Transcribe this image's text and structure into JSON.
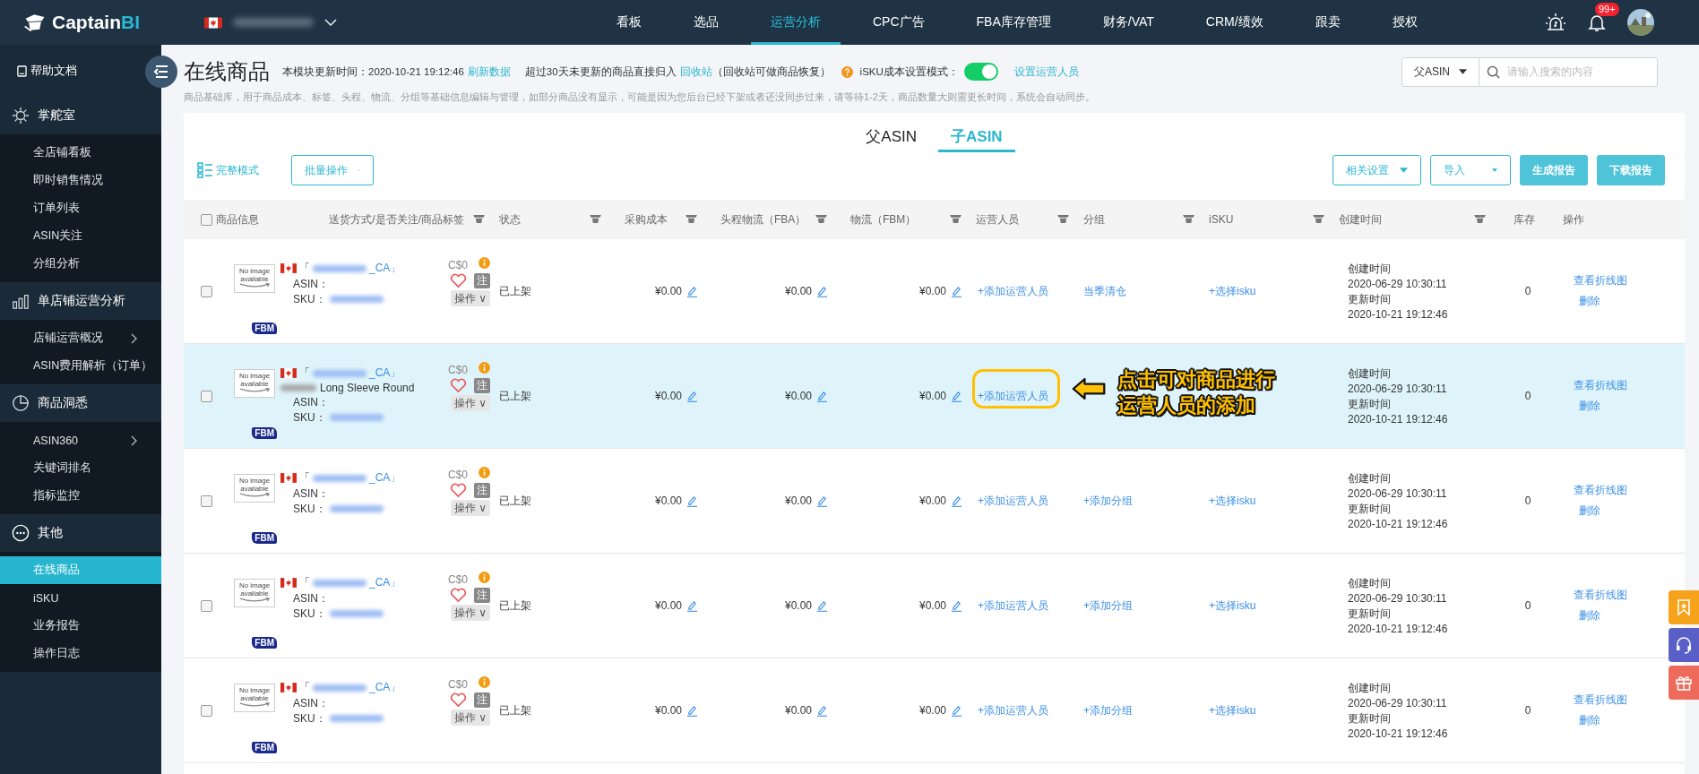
{
  "topbar": {
    "logo": [
      "Captain",
      "BI"
    ],
    "nav": [
      {
        "label": "看板",
        "selected": false
      },
      {
        "label": "选品",
        "selected": false
      },
      {
        "label": "运营分析",
        "selected": true
      },
      {
        "label": "CPC广告",
        "selected": false
      },
      {
        "label": "FBA库存管理",
        "selected": false
      },
      {
        "label": "财务/VAT",
        "selected": false
      },
      {
        "label": "CRM/绩效",
        "selected": false
      },
      {
        "label": "跟卖",
        "selected": false
      },
      {
        "label": "授权",
        "selected": false
      }
    ],
    "notifications": "99+"
  },
  "sidebar": {
    "help": "帮助文档",
    "sections": [
      {
        "label": "掌舵室",
        "items": [
          {
            "label": "全店铺看板",
            "selected": false,
            "submenu": false
          },
          {
            "label": "即时销售情况",
            "selected": false,
            "submenu": false
          },
          {
            "label": "订单列表",
            "selected": false,
            "submenu": false
          },
          {
            "label": "ASIN关注",
            "selected": false,
            "submenu": false
          },
          {
            "label": "分组分析",
            "selected": false,
            "submenu": false
          }
        ]
      },
      {
        "label": "单店铺运营分析",
        "items": [
          {
            "label": "店铺运营概况",
            "selected": false,
            "submenu": true
          },
          {
            "label": "ASIN费用解析（订单）",
            "selected": false,
            "submenu": false
          }
        ]
      },
      {
        "label": "商品洞悉",
        "items": [
          {
            "label": "ASIN360",
            "selected": false,
            "submenu": true
          },
          {
            "label": "关键词排名",
            "selected": false,
            "submenu": false
          },
          {
            "label": "指标监控",
            "selected": false,
            "submenu": false
          }
        ]
      },
      {
        "label": "其他",
        "items": [
          {
            "label": "在线商品",
            "selected": true,
            "submenu": false
          },
          {
            "label": "iSKU",
            "selected": false,
            "submenu": false
          },
          {
            "label": "业务报告",
            "selected": false,
            "submenu": false
          },
          {
            "label": "操作日志",
            "selected": false,
            "submenu": false
          }
        ]
      }
    ]
  },
  "page": {
    "title": "在线商品",
    "update_label": "本模块更新时间：2020-10-21 19:12:46",
    "refresh_link": "刷新数据",
    "recycle_text": "超过30天未更新的商品直接归入",
    "recycle_link": "回收站",
    "recycle_note": "（回收站可做商品恢复）",
    "isku_label": "iSKU成本设置模式：",
    "isku_mode_on": true,
    "set_operator_link": "设置运营人员",
    "search": {
      "scope": "父ASIN",
      "placeholder": "请输入搜索的内容"
    },
    "description": "商品基础库，用于商品成本、标签、头程、物流、分组等基础信息编辑与管理，如部分商品没有显示，可能是因为您后台已经下架或者还没同步过来，请等待1-2天，商品数量大则需更长时间，系统会自动同步。"
  },
  "asin_tabs": [
    {
      "label": "父ASIN",
      "selected": false
    },
    {
      "label": "子ASIN",
      "selected": true
    }
  ],
  "toolbar": {
    "mode": "完整模式",
    "batch": "批量操作",
    "settings": "相关设置",
    "import": "导入",
    "generate": "生成报告",
    "download": "下载报告"
  },
  "table": {
    "select_all": false,
    "columns": [
      {
        "label": "商品信息",
        "filter": false
      },
      {
        "label": "送货方式/是否关注/商品标签",
        "filter": true
      },
      {
        "label": "状态",
        "filter": true
      },
      {
        "label": "采购成本",
        "filter": true
      },
      {
        "label": "头程物流（FBA）",
        "filter": true
      },
      {
        "label": "物流（FBM）",
        "filter": true
      },
      {
        "label": "运营人员",
        "filter": true
      },
      {
        "label": "分组",
        "filter": true
      },
      {
        "label": "iSKU",
        "filter": true
      },
      {
        "label": "创建时间",
        "filter": true
      },
      {
        "label": "库存",
        "filter": false
      },
      {
        "label": "操作",
        "filter": false
      }
    ],
    "rows": [
      {
        "checked": false,
        "highlighted": false,
        "image": "No image available",
        "title_open": "「",
        "title_close": "_CA」",
        "price": "C$0",
        "asin_label": "ASIN：",
        "sku_label": "SKU：",
        "tag": "注",
        "ops": "操作 ∨",
        "fulfillment": "FBM",
        "status": "已上架",
        "cost": "¥0.00",
        "fba": "¥0.00",
        "fbm": "¥0.00",
        "operator": "+添加运营人员",
        "group": "当季清仓",
        "isku": "+选择isku",
        "created_label": "创建时间",
        "created": "2020-06-29 10:30:11",
        "updated_label": "更新时间",
        "updated": "2020-10-21 19:12:46",
        "stock": "0",
        "chart_link": "查看折线图",
        "delete_link": "删除"
      },
      {
        "checked": false,
        "highlighted": true,
        "image": "No image available",
        "title_open": "「",
        "title_close": "_CA」",
        "name": "Long Sleeve Round",
        "price": "C$0",
        "asin_label": "ASIN：",
        "sku_label": "SKU：",
        "tag": "注",
        "ops": "操作 ∨",
        "fulfillment": "FBM",
        "status": "已上架",
        "cost": "¥0.00",
        "fba": "¥0.00",
        "fbm": "¥0.00",
        "operator": "+添加运营人员",
        "callout": [
          "点击可对商品进行",
          "运营人员的添加"
        ],
        "created_label": "创建时间",
        "created": "2020-06-29 10:30:11",
        "updated_label": "更新时间",
        "updated": "2020-10-21 19:12:46",
        "stock": "0",
        "chart_link": "查看折线图",
        "delete_link": "删除"
      },
      {
        "checked": false,
        "highlighted": false,
        "image": "No image available",
        "title_open": "「",
        "title_close": "_CA」",
        "price": "C$0",
        "asin_label": "ASIN：",
        "sku_label": "SKU：",
        "tag": "注",
        "ops": "操作 ∨",
        "fulfillment": "FBM",
        "status": "已上架",
        "cost": "¥0.00",
        "fba": "¥0.00",
        "fbm": "¥0.00",
        "operator": "+添加运营人员",
        "group": "+添加分组",
        "isku": "+选择isku",
        "created_label": "创建时间",
        "created": "2020-06-29 10:30:11",
        "updated_label": "更新时间",
        "updated": "2020-10-21 19:12:46",
        "stock": "0",
        "chart_link": "查看折线图",
        "delete_link": "删除"
      },
      {
        "checked": false,
        "highlighted": false,
        "image": "No image available",
        "title_open": "「",
        "title_close": "_CA」",
        "price": "C$0",
        "asin_label": "ASIN：",
        "sku_label": "SKU：",
        "tag": "注",
        "ops": "操作 ∨",
        "fulfillment": "FBM",
        "status": "已上架",
        "cost": "¥0.00",
        "fba": "¥0.00",
        "fbm": "¥0.00",
        "operator": "+添加运营人员",
        "group": "+添加分组",
        "isku": "+选择isku",
        "created_label": "创建时间",
        "created": "2020-06-29 10:30:11",
        "updated_label": "更新时间",
        "updated": "2020-10-21 19:12:46",
        "stock": "0",
        "chart_link": "查看折线图",
        "delete_link": "删除"
      },
      {
        "checked": false,
        "highlighted": false,
        "image": "No image available",
        "title_open": "「",
        "title_close": "_CA」",
        "price": "C$0",
        "asin_label": "ASIN：",
        "sku_label": "SKU：",
        "tag": "注",
        "ops": "操作 ∨",
        "fulfillment": "FBM",
        "status": "已上架",
        "cost": "¥0.00",
        "fba": "¥0.00",
        "fbm": "¥0.00",
        "operator": "+添加运营人员",
        "group": "+添加分组",
        "isku": "+选择isku",
        "created_label": "创建时间",
        "created": "2020-06-29 10:30:11",
        "updated_label": "更新时间",
        "updated": "2020-10-21 19:12:46",
        "stock": "0",
        "chart_link": "查看折线图",
        "delete_link": "删除"
      }
    ]
  }
}
